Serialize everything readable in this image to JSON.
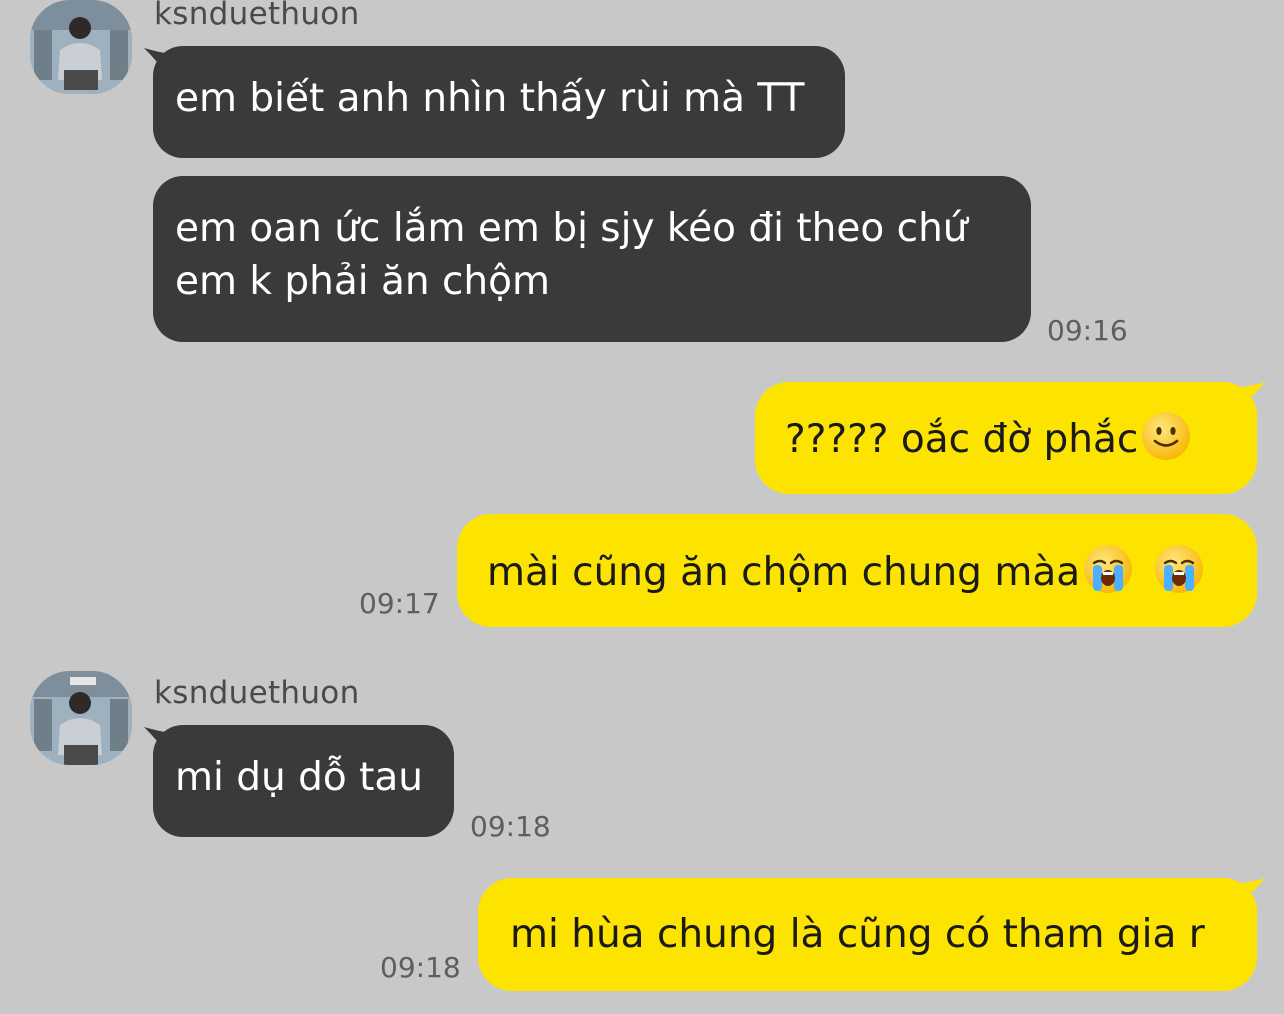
{
  "contact": {
    "name": "ksnduethuon"
  },
  "messages": [
    {
      "text": "em biết anh nhìn thấy rùi mà TT"
    },
    {
      "line1": "em oan ức lắm em bị sjy kéo đi theo chứ",
      "line2": "em k phải ăn chộm",
      "time": "09:16"
    },
    {
      "text": "????? oắc đờ phắc",
      "emoji": "slightly-smiling-face"
    },
    {
      "text": "mài cũng ăn chộm chung màa",
      "emoji": "loudly-crying-face",
      "time": "09:17"
    },
    {
      "text": "mi dụ dỗ tau",
      "time": "09:18"
    },
    {
      "text": "mi hùa chung là cũng có tham gia r",
      "time": "09:18"
    }
  ],
  "colors": {
    "background": "#c8c8c8",
    "incoming_bubble": "#3a3a3c",
    "outgoing_bubble": "#fde400",
    "timestamp": "#5e5e5e"
  }
}
